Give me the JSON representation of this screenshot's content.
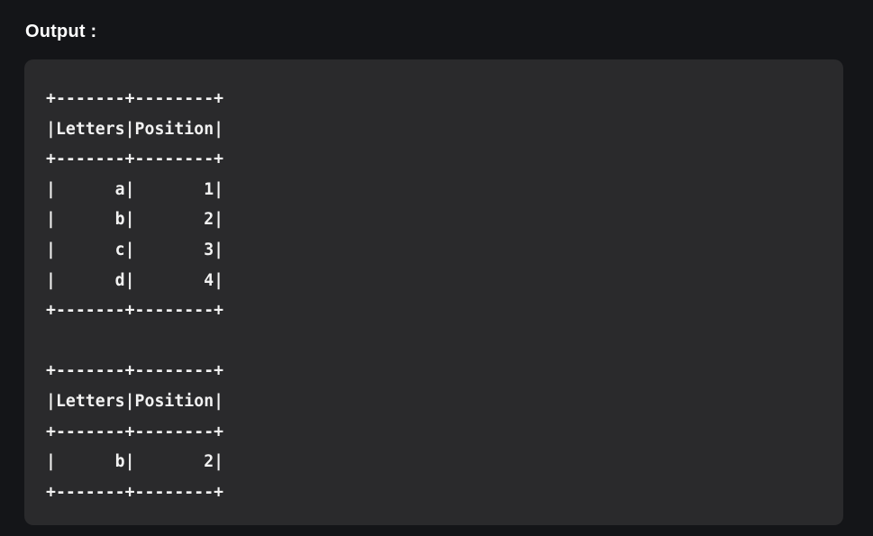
{
  "heading": "Output :",
  "output_lines": [
    "+-------+--------+",
    "|Letters|Position|",
    "+-------+--------+",
    "|      a|       1|",
    "|      b|       2|",
    "|      c|       3|",
    "|      d|       4|",
    "+-------+--------+",
    "",
    "+-------+--------+",
    "|Letters|Position|",
    "+-------+--------+",
    "|      b|       2|",
    "+-------+--------+"
  ]
}
